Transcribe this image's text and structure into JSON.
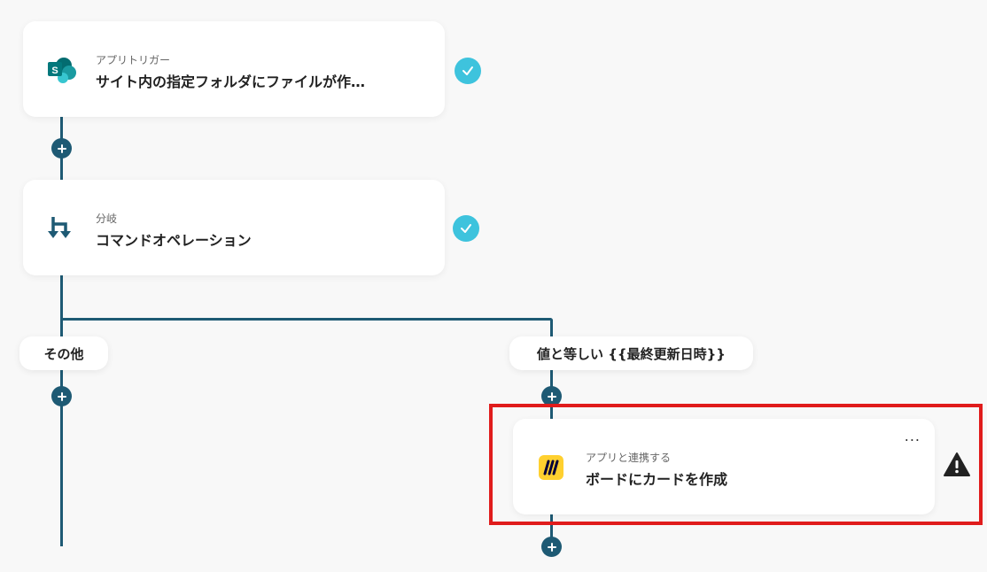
{
  "nodes": {
    "trigger": {
      "subtitle": "アプリトリガー",
      "title": "サイト内の指定フォルダにファイルが作…",
      "icon": "sharepoint-icon",
      "status": "check"
    },
    "branch": {
      "subtitle": "分岐",
      "title": "コマンドオペレーション",
      "icon": "branch-icon",
      "status": "check"
    },
    "miro_action": {
      "subtitle": "アプリと連携する",
      "title": "ボードにカードを作成",
      "icon": "miro-icon",
      "menu": "...",
      "status": "warning"
    }
  },
  "branches": {
    "other": "その他",
    "equals": "値と等しい {{最終更新日時}}"
  },
  "colors": {
    "connector": "#1e5a74",
    "check": "#3ec3dd",
    "highlight": "#e01c1c",
    "miro": "#ffd02f"
  }
}
